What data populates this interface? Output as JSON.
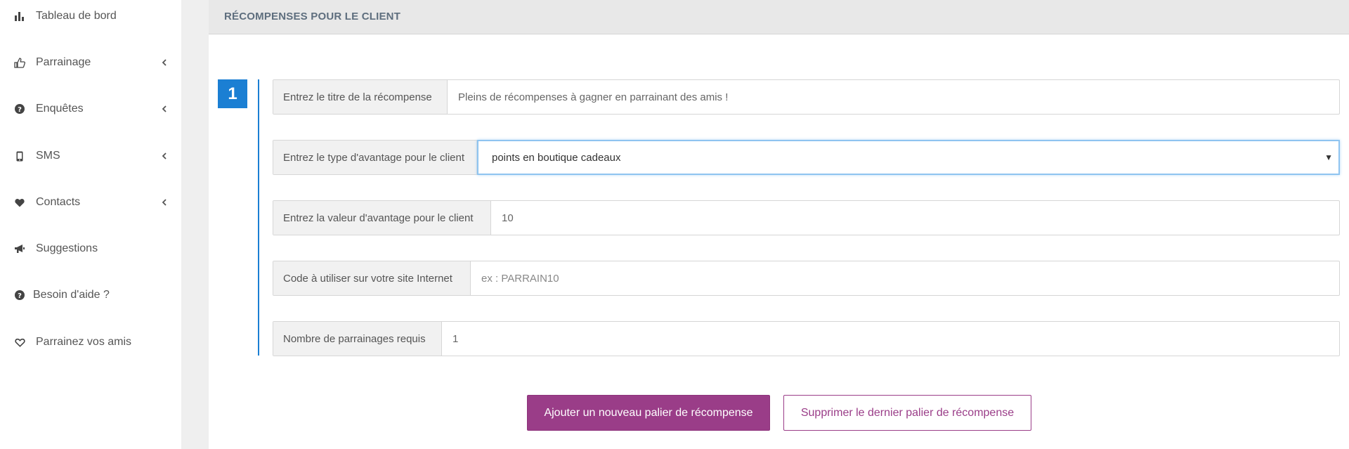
{
  "sidebar": {
    "items": [
      {
        "label": "Tableau de bord",
        "icon": "bar-chart-icon",
        "has_chevron": false
      },
      {
        "label": "Parrainage",
        "icon": "thumbs-up-icon",
        "has_chevron": true
      },
      {
        "label": "Enquêtes",
        "icon": "question-circle-icon",
        "has_chevron": true
      },
      {
        "label": "SMS",
        "icon": "mobile-icon",
        "has_chevron": true
      },
      {
        "label": "Contacts",
        "icon": "heart-icon",
        "has_chevron": true
      },
      {
        "label": "Suggestions",
        "icon": "megaphone-icon",
        "has_chevron": false
      },
      {
        "label": "Besoin d'aide ?",
        "icon": "question-circle-icon",
        "has_chevron": false
      },
      {
        "label": "Parrainez vos amis",
        "icon": "heart-outline-icon",
        "has_chevron": false
      }
    ]
  },
  "panel": {
    "title": "RÉCOMPENSES POUR LE CLIENT",
    "step_number": "1",
    "fields": {
      "title": {
        "label": "Entrez le titre de la récompense",
        "value": "Pleins de récompenses à gagner en parrainant des amis !"
      },
      "type": {
        "label": "Entrez le type d'avantage pour le client",
        "value": "points en boutique cadeaux"
      },
      "value": {
        "label": "Entrez la valeur d'avantage pour le client",
        "value": "10"
      },
      "code": {
        "label": "Code à utiliser sur votre site Internet",
        "placeholder": "ex : PARRAIN10"
      },
      "count": {
        "label": "Nombre de parrainages requis",
        "value": "1"
      }
    },
    "buttons": {
      "add": "Ajouter un nouveau palier de récompense",
      "remove": "Supprimer le dernier palier de récompense"
    }
  },
  "colors": {
    "accent": "#1b7fd3",
    "brand": "#9a3d88"
  }
}
